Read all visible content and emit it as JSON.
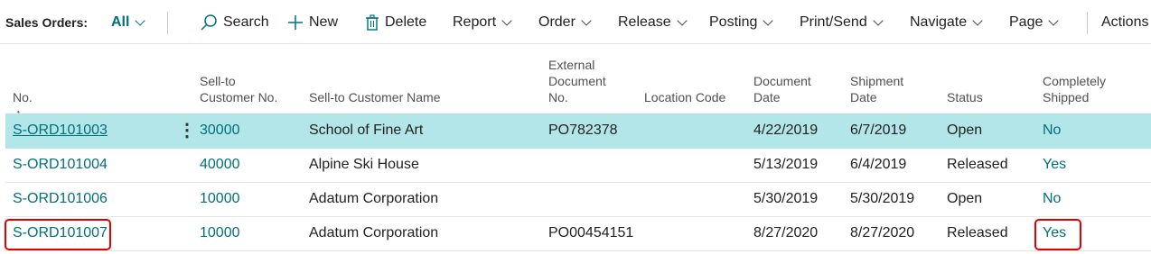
{
  "toolbar": {
    "title": "Sales Orders:",
    "filter": "All",
    "search": "Search",
    "new": "New",
    "delete": "Delete",
    "report": "Report",
    "order": "Order",
    "release": "Release",
    "posting": "Posting",
    "print_send": "Print/Send",
    "navigate": "Navigate",
    "page": "Page",
    "actions": "Actions"
  },
  "columns": {
    "no": "No.",
    "no_sort_indicator": "↑",
    "sell_to_no_1": "Sell-to",
    "sell_to_no_2": "Customer No.",
    "sell_to_name": "Sell-to Customer Name",
    "ext_doc_1": "External",
    "ext_doc_2": "Document",
    "ext_doc_3": "No.",
    "location": "Location Code",
    "doc_date_1": "Document",
    "doc_date_2": "Date",
    "ship_date_1": "Shipment",
    "ship_date_2": "Date",
    "status": "Status",
    "completely_1": "Completely",
    "completely_2": "Shipped"
  },
  "rows": [
    {
      "no": "S-ORD101003",
      "cust_no": "30000",
      "name": "School of Fine Art",
      "ext_doc": "PO782378",
      "location": "",
      "doc_date": "4/22/2019",
      "ship_date": "6/7/2019",
      "status": "Open",
      "shipped": "No"
    },
    {
      "no": "S-ORD101004",
      "cust_no": "40000",
      "name": "Alpine Ski House",
      "ext_doc": "",
      "location": "",
      "doc_date": "5/13/2019",
      "ship_date": "6/4/2019",
      "status": "Released",
      "shipped": "Yes"
    },
    {
      "no": "S-ORD101006",
      "cust_no": "10000",
      "name": "Adatum Corporation",
      "ext_doc": "",
      "location": "",
      "doc_date": "5/30/2019",
      "ship_date": "5/30/2019",
      "status": "Open",
      "shipped": "No"
    },
    {
      "no": "S-ORD101007",
      "cust_no": "10000",
      "name": "Adatum Corporation",
      "ext_doc": "PO00454151",
      "location": "",
      "doc_date": "8/27/2020",
      "ship_date": "8/27/2020",
      "status": "Released",
      "shipped": "Yes"
    }
  ],
  "row_menu_glyph": "⋮",
  "colors": {
    "accent": "#00707a",
    "selected_row": "#b3e6e8",
    "callout": "#e00000"
  }
}
